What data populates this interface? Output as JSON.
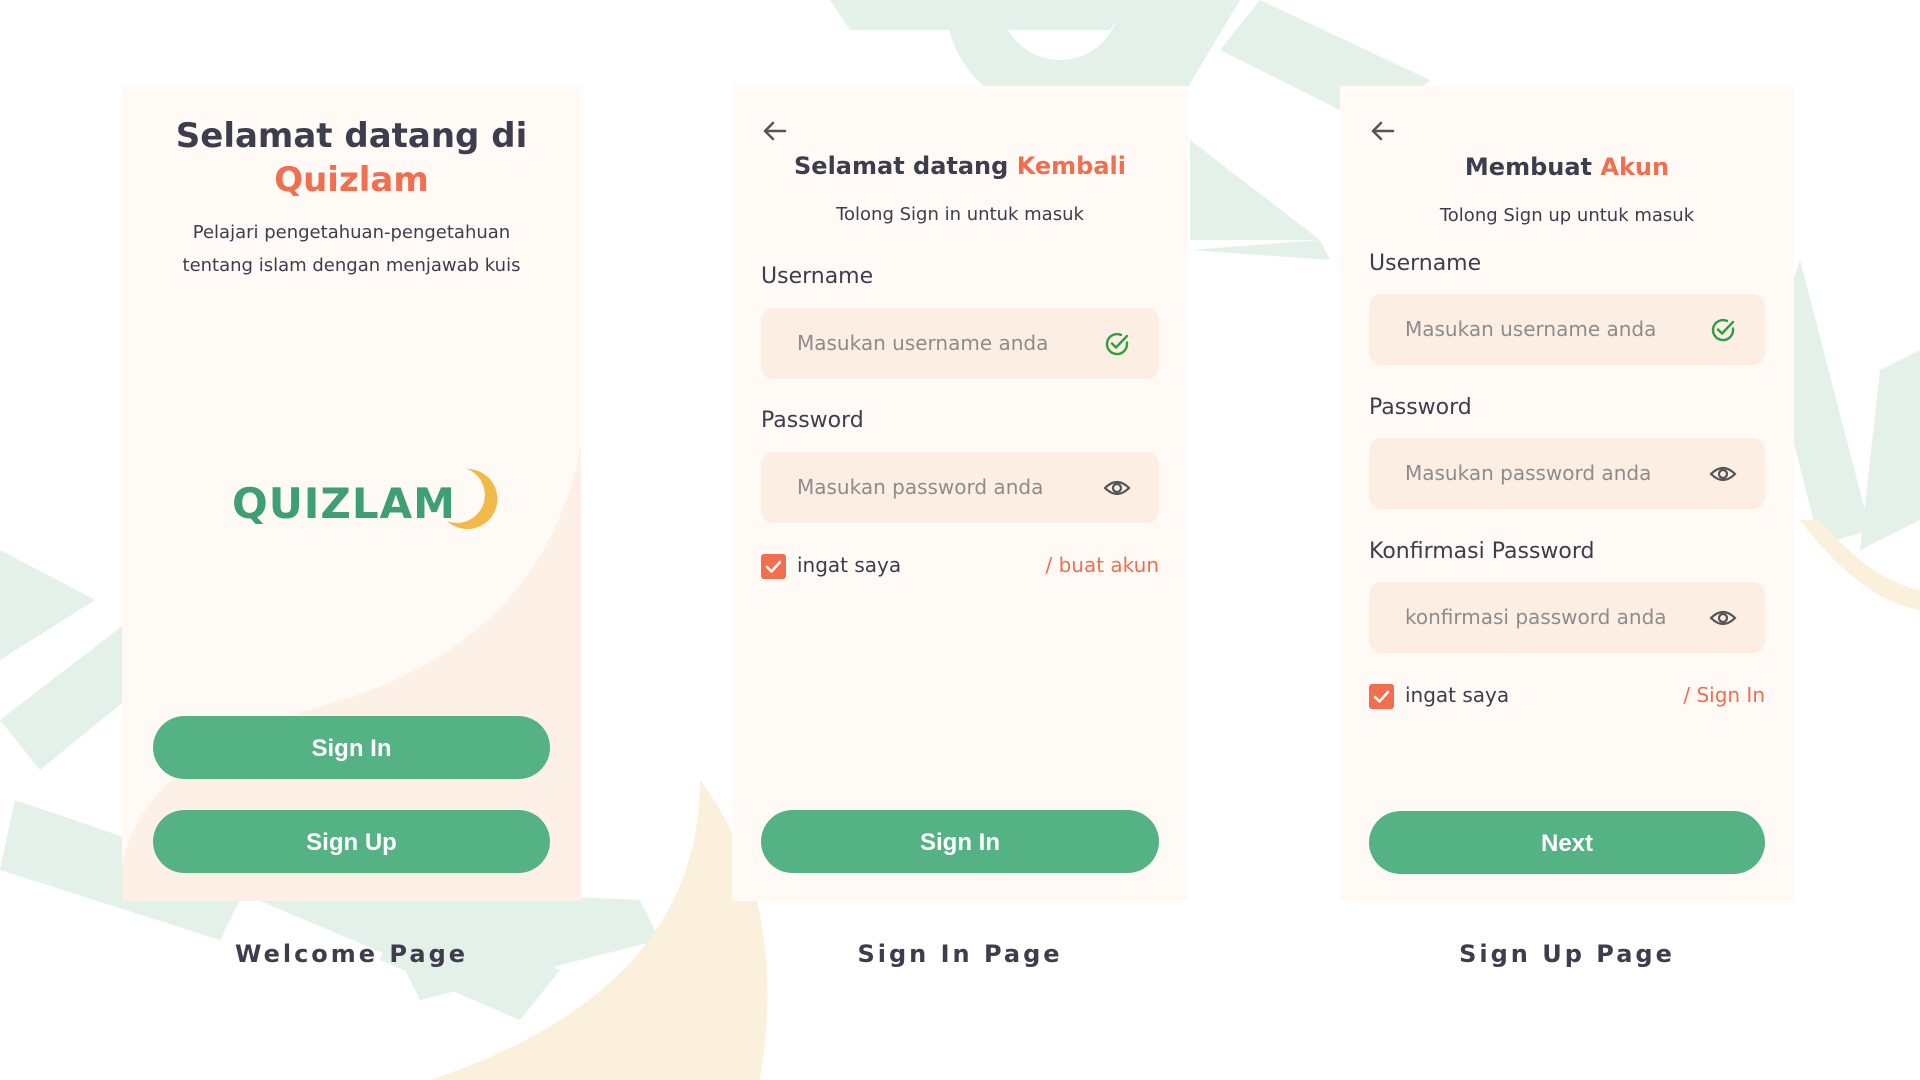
{
  "welcome": {
    "title_line1": "Selamat datang di",
    "title_line2": "Quizlam",
    "description_line1": "Pelajari pengetahuan-pengetahuan",
    "description_line2": "tentang islam dengan menjawab kuis",
    "logo_text": "QUIZLAM",
    "signin_label": "Sign In",
    "signup_label": "Sign Up",
    "caption": "Welcome Page"
  },
  "signin": {
    "heading_main": "Selamat datang ",
    "heading_accent": "Kembali",
    "subtitle": "Tolong Sign in untuk masuk",
    "username_label": "Username",
    "username_placeholder": "Masukan username anda",
    "password_label": "Password",
    "password_placeholder": "Masukan password anda",
    "remember_label": "ingat saya",
    "create_link": "/ buat akun",
    "button_label": "Sign In",
    "caption": "Sign In Page"
  },
  "signup": {
    "heading_main": "Membuat ",
    "heading_accent": "Akun",
    "subtitle": "Tolong Sign up untuk masuk",
    "username_label": "Username",
    "username_placeholder": "Masukan username anda",
    "password_label": "Password",
    "password_placeholder": "Masukan password anda",
    "confirm_label": "Konfirmasi Password",
    "confirm_placeholder": "konfirmasi password anda",
    "remember_label": "ingat saya",
    "signin_link": "/ Sign In",
    "button_label": "Next",
    "caption": "Sign Up Page"
  },
  "icons": {
    "back": "arrow-left-icon",
    "valid": "check-circle-icon",
    "reveal": "eye-icon",
    "checkbox": "checkmark-icon"
  },
  "colors": {
    "primary_green": "#55b284",
    "accent_orange": "#ef6f50",
    "text_dark": "#3d3d4e",
    "card_background": "#fffaf5",
    "input_background": "#fdeee4",
    "valid_green": "#2e9e3e",
    "logo_green": "#3d9f72",
    "moon_yellow": "#f2b94a"
  }
}
